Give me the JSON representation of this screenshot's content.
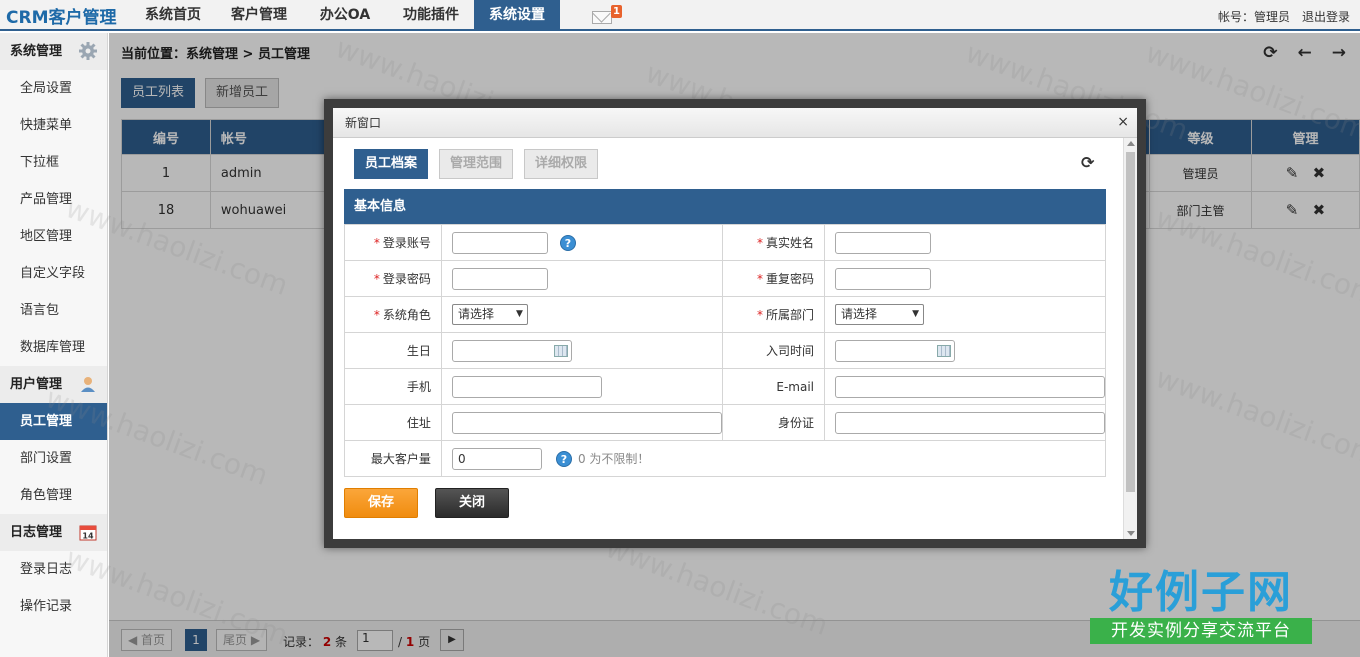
{
  "app": {
    "logo": "CRM客户管理",
    "nav": [
      "系统首页",
      "客户管理",
      "办公OA",
      "功能插件",
      "系统设置"
    ],
    "nav_active_index": 4,
    "mail_badge": "1",
    "account": "帐号：管理员",
    "logout": "退出登录"
  },
  "sidebar": {
    "group1": "系统管理",
    "group1_items": [
      "全局设置",
      "快捷菜单",
      "下拉框",
      "产品管理",
      "地区管理",
      "自定义字段",
      "语言包",
      "数据库管理"
    ],
    "group2": "用户管理",
    "group2_items": [
      "员工管理",
      "部门设置",
      "角色管理"
    ],
    "group3": "日志管理",
    "group3_items": [
      "登录日志",
      "操作记录"
    ]
  },
  "main": {
    "breadcrumb": "当前位置：系统管理 > 员工管理",
    "tabs": [
      "员工列表",
      "新增员工"
    ],
    "columns": [
      "编号",
      "帐号",
      "等级",
      "管理"
    ],
    "rows": [
      {
        "id": "1",
        "account": "admin",
        "level": "管理员"
      },
      {
        "id": "18",
        "account": "wohuawei",
        "level": "部门主管"
      }
    ],
    "pager": {
      "first": "◀ 首页",
      "current_page": "1",
      "last": "尾页 ▶",
      "records_label": "记录：",
      "records_count": "2",
      "records_unit": "条",
      "page_input": "1",
      "page_sep": "/",
      "total_pages": "1",
      "page_unit": "页"
    }
  },
  "dialog": {
    "title": "新窗口",
    "close": "×",
    "tabs": [
      "员工档案",
      "管理范围",
      "详细权限"
    ],
    "section": "基本信息",
    "labels": {
      "login_account": "登录账号",
      "real_name": "真实姓名",
      "login_password": "登录密码",
      "repeat_password": "重复密码",
      "system_role": "系统角色",
      "department": "所属部门",
      "birthday": "生日",
      "hire_date": "入司时间",
      "mobile": "手机",
      "email": "E-mail",
      "address": "住址",
      "id_card": "身份证",
      "max_customers": "最大客户量"
    },
    "required_mark": "*",
    "select_placeholder": "请选择",
    "max_customers_value": "0",
    "max_customers_hint": "0 为不限制！",
    "save": "保存",
    "close_btn": "关闭"
  },
  "watermark": {
    "text": "www.haolizi.com",
    "brand_big": "好例子网",
    "brand_small": "开发实例分享交流平台"
  },
  "colors": {
    "primary": "#2f5f8f",
    "save": "#f39a1e",
    "brand_blue": "#2a9fd8",
    "brand_green": "#3ab14a"
  }
}
